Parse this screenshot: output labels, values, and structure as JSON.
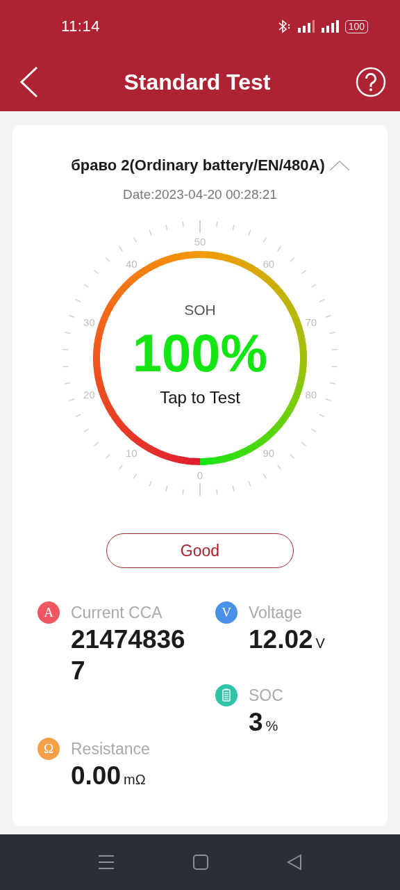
{
  "status_bar": {
    "time": "11:14",
    "battery": "100"
  },
  "header": {
    "title": "Standard Test"
  },
  "battery_info": {
    "title": "браво 2(Ordinary battery/EN/480A)",
    "expanded": true,
    "date": "Date:2023-04-20 00:28:21"
  },
  "gauge": {
    "ticks": [
      "0",
      "10",
      "20",
      "30",
      "40",
      "50",
      "60",
      "70",
      "80",
      "90"
    ],
    "label": "SOH",
    "value": "100%",
    "action": "Tap to Test"
  },
  "result": {
    "label": "Good"
  },
  "metrics": [
    {
      "kind": "letter",
      "badge": "A",
      "color": "#f0565f",
      "label": "Current CCA",
      "value_lines": [
        "21474836",
        "7"
      ]
    },
    {
      "kind": "letter",
      "badge": "Ω",
      "color": "#f6a04a",
      "label": "Resistance",
      "value_lines": [
        "0.00"
      ],
      "unit": "mΩ"
    },
    {
      "kind": "letter",
      "badge": "V",
      "color": "#4a8fe8",
      "label": "Voltage",
      "value_lines": [
        "12.02"
      ],
      "unit": "V"
    },
    {
      "kind": "battery",
      "color": "#2fc3a8",
      "label": "SOC",
      "value_lines": [
        "3"
      ],
      "unit": "%"
    }
  ]
}
